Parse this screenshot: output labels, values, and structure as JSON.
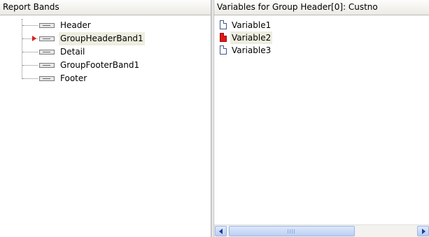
{
  "left_panel": {
    "header": "Report Bands",
    "bands": [
      {
        "label": "Header",
        "selected": false,
        "icon": "band-icon"
      },
      {
        "label": "GroupHeaderBand1",
        "selected": true,
        "icon": "band-icon"
      },
      {
        "label": "Detail",
        "selected": false,
        "icon": "band-icon"
      },
      {
        "label": "GroupFooterBand1",
        "selected": false,
        "icon": "band-icon"
      },
      {
        "label": "Footer",
        "selected": false,
        "icon": "band-icon"
      }
    ],
    "selection_marker_icon": "red-arrow-icon",
    "selection_color": "#e0201a"
  },
  "right_panel": {
    "header": "Variables for Group Header[0]: Custno",
    "variables": [
      {
        "label": "Variable1",
        "selected": false,
        "icon": "document-icon"
      },
      {
        "label": "Variable2",
        "selected": true,
        "icon": "red-document-icon"
      },
      {
        "label": "Variable3",
        "selected": false,
        "icon": "document-icon"
      }
    ],
    "scrollbar": {
      "left_icon": "chevron-left-icon",
      "right_icon": "chevron-right-icon",
      "thumb_icon": "grip-icon"
    }
  },
  "colors": {
    "selection_bg": "#eeeee0",
    "scroll_accent": "#1e3f9a"
  }
}
